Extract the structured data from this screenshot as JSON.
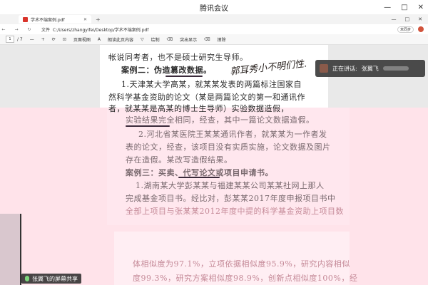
{
  "meeting": {
    "title": "腾讯会议",
    "controls": [
      "—",
      "□",
      "✕"
    ]
  },
  "browser": {
    "tab_title": "学术不端案例.pdf",
    "tab_close": "✕",
    "tab_add": "+",
    "window_controls": [
      "—",
      "□",
      "✕"
    ],
    "nav": [
      "←",
      "→",
      "↻"
    ],
    "address_prefix": "文件",
    "address": "C:/Users/zhangyifei/Desktop/学术不端案例.pdf",
    "unsync_label": "未同步"
  },
  "pdf_toolbar": {
    "page_current": "1",
    "page_total": "/ 7",
    "items": [
      "—",
      "+",
      "⟳",
      "⊡",
      "页面视图",
      "A",
      "朗读此页内容",
      "▽",
      "绘制",
      "⌫",
      "突出显示",
      "⌫",
      "擦除"
    ]
  },
  "document": {
    "lines": [
      "帐说同考者，也不是硕士研究生导师。",
      "案例二：伪造篡改数据。",
      "1.天津某大学高某，就某某发表的两篇标注国家自",
      "然科学基金资助的论文（某是两篇论文的第一和通讯作",
      "者，就某某是高某的博士生导师）实验数据造假，",
      "实验结果完全相同，经查，其中一篇论文数据造假。",
      "2.河北省某医院王某某通讯作者，就某某为一作者发",
      "表的论文，经查，该项目没有实质实施，论文数据及图片",
      "存在造假。某改写造假结果。",
      "案例三：买卖、代写论文或项目申请书。",
      "1.湖南某大学彭某某与福建某某公司某某社网上那人",
      "完成基金项目书。经比对，彭某某2017年度申报项目书中",
      "全部上项目与张某某2012年度中提的科学基金资助上项目数",
      "体相似度为97.1%，立项依据相似度95.9%，研究内容相似",
      "度99.3%，研究方案相似度98.9%，创新点相似度100%，经"
    ],
    "handwriting": "郭耳秀小不明们性."
  },
  "speaker": {
    "label": "正在讲话:",
    "name": "张翼飞"
  },
  "share_label": "张翼飞的屏幕共享"
}
